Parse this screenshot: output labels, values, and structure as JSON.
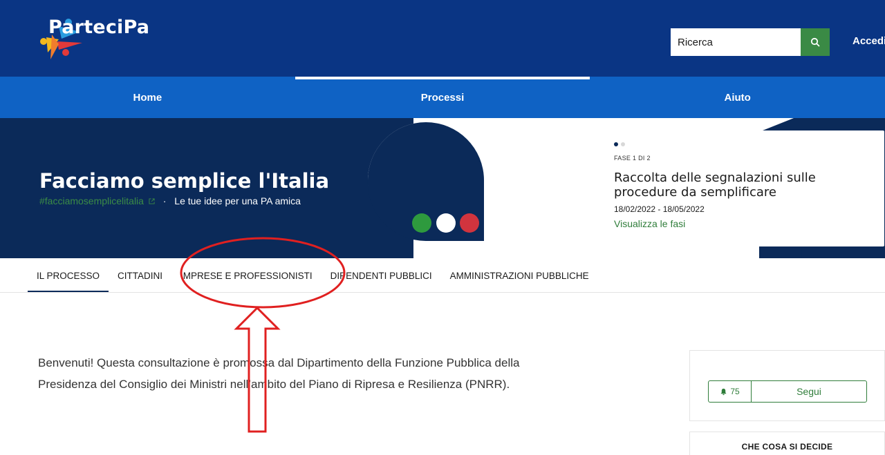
{
  "header": {
    "logo_text": "ParteciPa",
    "search_placeholder": "Ricerca",
    "login_label": "Accedi"
  },
  "nav": {
    "items": [
      {
        "label": "Home",
        "active": false
      },
      {
        "label": "Processi",
        "active": true
      },
      {
        "label": "Aiuto",
        "active": false
      }
    ]
  },
  "hero": {
    "title": "Facciamo semplice l'Italia",
    "hashtag": "#facciamosemplicelitalia",
    "separator": "·",
    "subtitle": "Le tue idee per una PA amica",
    "colors": {
      "green": "#2e9a3e",
      "white": "#ffffff",
      "red": "#d1343e",
      "navy": "#0b2a59"
    }
  },
  "phase": {
    "label": "FASE 1 DI 2",
    "title": "Raccolta delle segnalazioni sulle procedure da semplificare",
    "dates": "18/02/2022 - 18/05/2022",
    "link": "Visualizza le fasi"
  },
  "tabs": [
    {
      "label": "IL PROCESSO",
      "active": true
    },
    {
      "label": "CITTADINI",
      "active": false
    },
    {
      "label": "IMPRESE E PROFESSIONISTI",
      "active": false
    },
    {
      "label": "DIPENDENTI PUBBLICI",
      "active": false
    },
    {
      "label": "AMMINISTRAZIONI PUBBLICHE",
      "active": false
    }
  ],
  "intro": {
    "text": "Benvenuti! Questa consultazione è promossa dal Dipartimento della Funzione Pubblica della Presidenza del Consiglio dei Ministri nell’ambito del Piano di Ripresa e Resilienza (PNRR)."
  },
  "sidebar": {
    "follower_count": "75",
    "follow_label": "Segui",
    "decide_heading": "CHE COSA SI DECIDE"
  },
  "annotation": {
    "color": "#e02020"
  }
}
